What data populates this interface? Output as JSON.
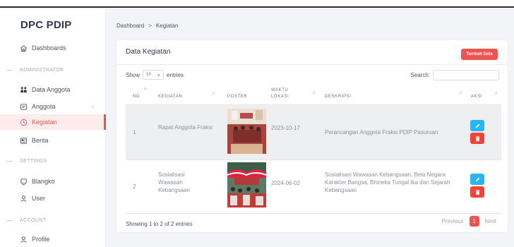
{
  "sidebar": {
    "brand": "DPC PDIP",
    "items": [
      {
        "label": "Dashboards"
      },
      {
        "label": "Data Anggota"
      },
      {
        "label": "Anggota"
      },
      {
        "label": "Kegiatan"
      },
      {
        "label": "Berita"
      },
      {
        "label": "Blangko"
      },
      {
        "label": "User"
      },
      {
        "label": "Profile"
      }
    ],
    "sections": [
      "ADMINISTRATOR",
      "SETTINGS",
      "ACCOUNT"
    ]
  },
  "breadcrumb": {
    "root": "Dashboard",
    "sep": ">",
    "current": "Kegiatan"
  },
  "card": {
    "title": "Data Kegiatan",
    "add_label": "Tambah Data",
    "show_label": "Show",
    "show_value": "10",
    "entries_label": "entries",
    "search_label": "Search:",
    "search_value": ""
  },
  "table": {
    "headers": {
      "no": "NO",
      "kegiatan": "KEGIATAN",
      "poster": "POSTER",
      "waktu": "WAKTU",
      "lokasi": "LOKASI",
      "deskripsi": "DESKRIPSI",
      "aksi": "AKSI"
    },
    "rows": [
      {
        "no": "1",
        "kegiatan": "Rapat Anggota Fraksi",
        "waktu": "2023-10-17",
        "deskripsi": "Perancangan Anggota Fraksi PDIP Pasuruan"
      },
      {
        "no": "2",
        "kegiatan": "Sosialisasi Wawasan Kebangsaan",
        "waktu": "2024-06-02",
        "deskripsi": "Sosialisasi Wawasan Kebangsaan, Bela Negara Karakter Bangsa, Bhineka Tungal Ika dan Sejarah Kebangsaan"
      }
    ]
  },
  "footer": {
    "info": "Showing 1 to 2 of 2 entries",
    "previous": "Previous",
    "page": "1",
    "next": "Next"
  },
  "colors": {
    "accent": "#ef5350",
    "edit": "#29b6f6",
    "delete": "#f44336",
    "active_bg": "#fdeceb"
  }
}
